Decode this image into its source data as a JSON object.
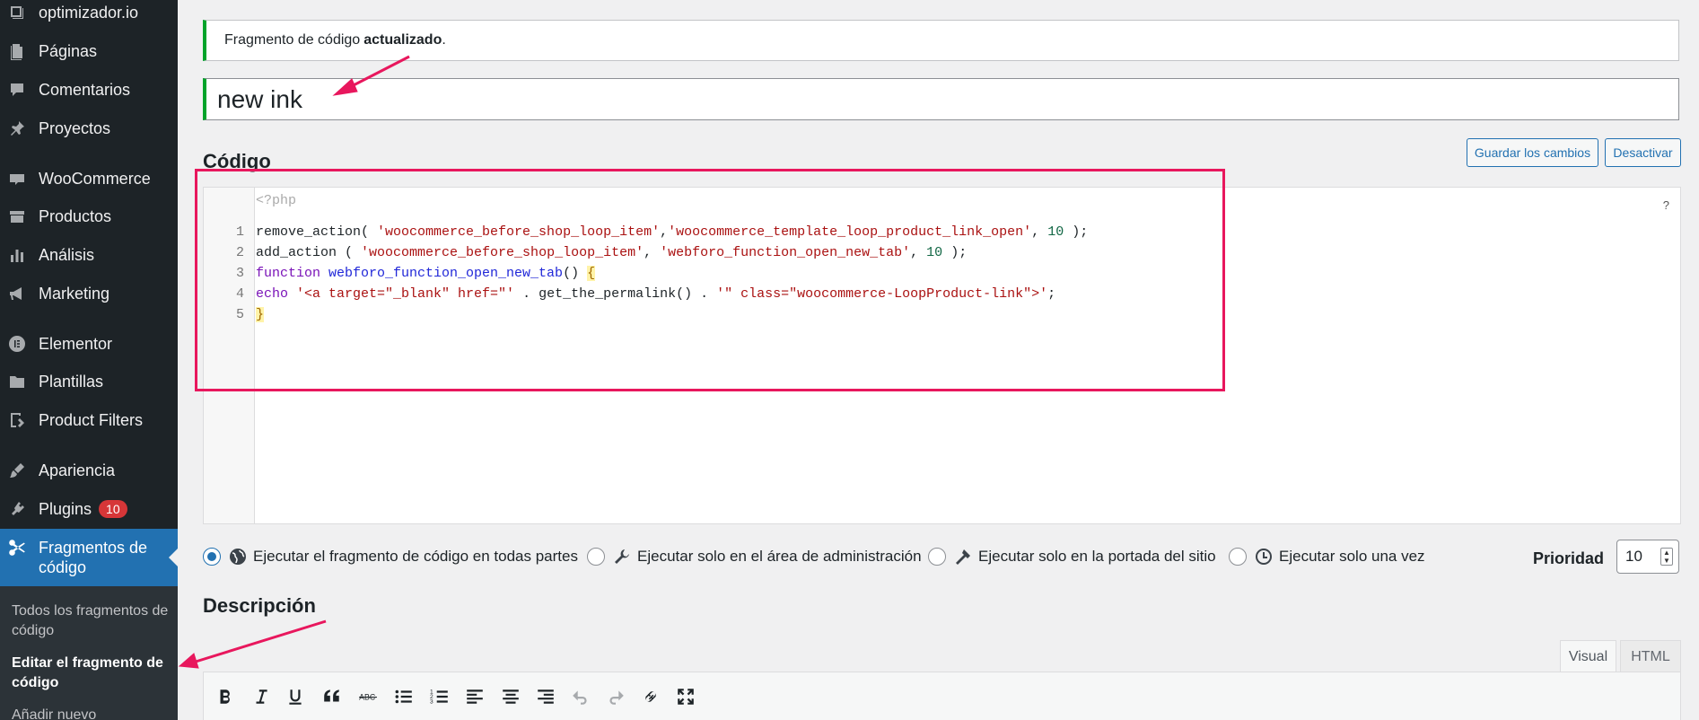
{
  "sidebar": {
    "items": [
      {
        "label": "optimizador.io",
        "icon": "media-icon"
      },
      {
        "label": "Páginas",
        "icon": "pages-icon"
      },
      {
        "label": "Comentarios",
        "icon": "comments-icon"
      },
      {
        "label": "Proyectos",
        "icon": "pin-icon"
      },
      {
        "label": "WooCommerce",
        "icon": "woocommerce-icon"
      },
      {
        "label": "Productos",
        "icon": "products-icon"
      },
      {
        "label": "Análisis",
        "icon": "analytics-icon"
      },
      {
        "label": "Marketing",
        "icon": "megaphone-icon"
      },
      {
        "label": "Elementor",
        "icon": "elementor-icon"
      },
      {
        "label": "Plantillas",
        "icon": "folder-icon"
      },
      {
        "label": "Product Filters",
        "icon": "filter-icon"
      },
      {
        "label": "Apariencia",
        "icon": "brush-icon"
      },
      {
        "label": "Plugins",
        "icon": "plugin-icon",
        "badge": "10"
      }
    ],
    "active": {
      "label": "Fragmentos de código",
      "icon": "scissors-icon"
    },
    "submenu": [
      {
        "label": "Todos los fragmentos de código"
      },
      {
        "label": "Editar el fragmento de código"
      },
      {
        "label": "Añadir nuevo"
      }
    ]
  },
  "notice": {
    "text": "Fragmento de código",
    "bold": "actualizado",
    "suffix": "."
  },
  "snippet": {
    "title": "new ink"
  },
  "code_section": {
    "title": "Código",
    "help": "?"
  },
  "buttons": {
    "save": "Guardar los cambios",
    "deactivate": "Desactivar"
  },
  "code": {
    "header": "<?php",
    "line_numbers": [
      "1",
      "2",
      "3",
      "4",
      "5"
    ],
    "lines": [
      [
        {
          "t": "remove_action( ",
          "c": "plain"
        },
        {
          "t": "'woocommerce_before_shop_loop_item'",
          "c": "str"
        },
        {
          "t": ",",
          "c": "plain"
        },
        {
          "t": "'woocommerce_template_loop_product_link_open'",
          "c": "str"
        },
        {
          "t": ", ",
          "c": "plain"
        },
        {
          "t": "10",
          "c": "num"
        },
        {
          "t": " );",
          "c": "plain"
        }
      ],
      [
        {
          "t": "add_action ( ",
          "c": "plain"
        },
        {
          "t": "'woocommerce_before_shop_loop_item'",
          "c": "str"
        },
        {
          "t": ", ",
          "c": "plain"
        },
        {
          "t": "'webforo_function_open_new_tab'",
          "c": "str"
        },
        {
          "t": ", ",
          "c": "plain"
        },
        {
          "t": "10",
          "c": "num"
        },
        {
          "t": " );",
          "c": "plain"
        }
      ],
      [
        {
          "t": "function ",
          "c": "kw"
        },
        {
          "t": "webforo_function_open_new_tab",
          "c": "fn"
        },
        {
          "t": "() ",
          "c": "plain"
        },
        {
          "t": "{",
          "c": "brk"
        }
      ],
      [
        {
          "t": "echo ",
          "c": "kw"
        },
        {
          "t": "'<a target=\"_blank\" href=\"'",
          "c": "str"
        },
        {
          "t": " . get_the_permalink() . ",
          "c": "plain"
        },
        {
          "t": "'\" class=\"woocommerce-LoopProduct-link\">'",
          "c": "str"
        },
        {
          "t": ";",
          "c": "plain"
        }
      ],
      [
        {
          "t": "}",
          "c": "brk"
        }
      ]
    ]
  },
  "scope": {
    "options": [
      {
        "label": "Ejecutar el fragmento de código en todas partes",
        "icon": "globe-icon",
        "checked": true
      },
      {
        "label": "Ejecutar solo en el área de administración",
        "icon": "wrench-icon",
        "checked": false
      },
      {
        "label": "Ejecutar solo en la portada del sitio",
        "icon": "hammer-icon",
        "checked": false
      },
      {
        "label": "Ejecutar solo una vez",
        "icon": "clock-icon",
        "checked": false
      }
    ]
  },
  "priority": {
    "label": "Prioridad",
    "value": "10"
  },
  "description": {
    "title": "Descripción"
  },
  "editor_tabs": {
    "visual": "Visual",
    "html": "HTML"
  },
  "toolbar": {
    "icons": [
      "bold-icon",
      "italic-icon",
      "underline-icon",
      "blockquote-icon",
      "strikethrough-icon",
      "bullet-list-icon",
      "numbered-list-icon",
      "align-left-icon",
      "align-center-icon",
      "align-right-icon",
      "undo-icon",
      "redo-icon",
      "link-icon",
      "fullscreen-icon"
    ]
  },
  "colors": {
    "accent": "#2271b1",
    "sidebar": "#1d2327",
    "success": "#00a32a",
    "annotation": "#e8175d",
    "badge": "#d63638"
  }
}
